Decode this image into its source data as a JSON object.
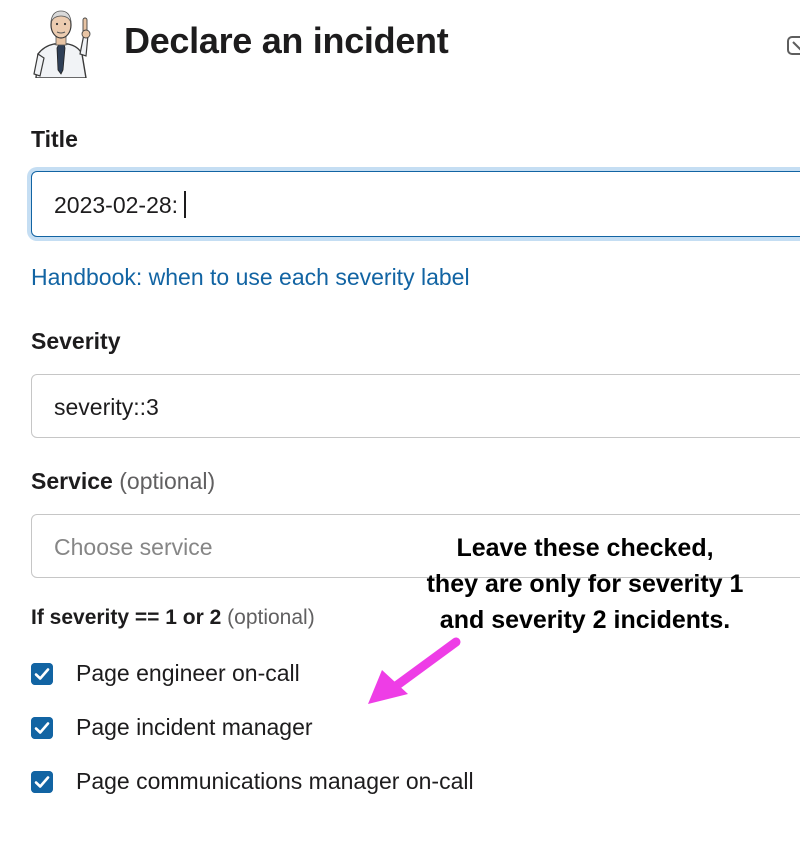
{
  "modal": {
    "title": "Declare an incident"
  },
  "form": {
    "title_label": "Title",
    "title_value": "2023-02-28:",
    "handbook_link": "Handbook: when to use each severity label",
    "severity_label": "Severity",
    "severity_value": "severity::3",
    "service_label": "Service",
    "service_optional": "(optional)",
    "service_placeholder": "Choose service",
    "paging_label": "If severity == 1 or 2",
    "paging_optional": "(optional)",
    "checkboxes": [
      {
        "label": "Page engineer on-call",
        "checked": true
      },
      {
        "label": "Page incident manager",
        "checked": true
      },
      {
        "label": "Page communications manager on-call",
        "checked": true
      }
    ]
  },
  "annotation": {
    "line1": "Leave these checked,",
    "line2": "they are only for severity 1",
    "line3": "and severity 2 incidents."
  },
  "colors": {
    "accent": "#1264a3",
    "focus_ring": "#c5def3",
    "arrow": "#ee3de6"
  },
  "icons": {
    "avatar": "man-pointing-avatar",
    "close": "close-icon"
  }
}
